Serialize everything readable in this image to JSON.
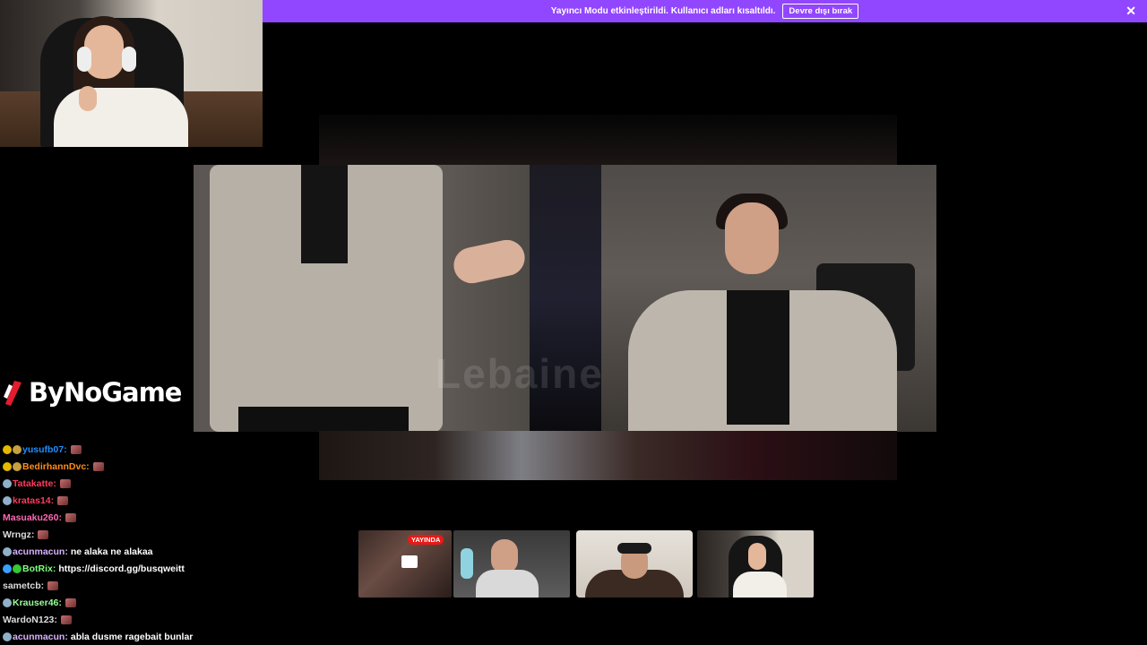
{
  "banner": {
    "message": "Yayıncı Modu etkinleştirildi. Kullanıcı adları kısaltıldı.",
    "button_label": "Devre dışı bırak",
    "close_glyph": "✕",
    "color": "#9146ff"
  },
  "overlay": {
    "logo_text": "ByNoGame",
    "watermark": "Lebaine",
    "live_label": "YAYINDA"
  },
  "chat": {
    "messages": [
      {
        "user": "yusufb07:",
        "color": "#1e90ff",
        "text": "",
        "badges": [
          "#e6b800",
          "#c8a040"
        ],
        "emote": true
      },
      {
        "user": "BedirhannDvc:",
        "color": "#ff8c1a",
        "text": "",
        "badges": [
          "#e6b800",
          "#c8a040"
        ],
        "emote": true
      },
      {
        "user": "Tatakatte:",
        "color": "#ff3b5c",
        "text": "",
        "badges": [
          "#8fb0c8"
        ],
        "emote": true
      },
      {
        "user": "kratas14:",
        "color": "#ff3b5c",
        "text": "",
        "badges": [
          "#8fb0c8"
        ],
        "emote": true
      },
      {
        "user": "Masuaku260:",
        "color": "#ff69b4",
        "text": "",
        "badges": [],
        "emote": true
      },
      {
        "user": "Wrngz:",
        "color": "#dcdcdc",
        "text": "",
        "badges": [],
        "emote": true
      },
      {
        "user": "acunmacun:",
        "color": "#d8b4fe",
        "text": "ne alaka ne alakaa",
        "badges": [
          "#8fb0c8"
        ],
        "emote": false
      },
      {
        "user": "BotRix:",
        "color": "#7fff7f",
        "text": "https://discord.gg/busqweitt",
        "badges": [
          "#3aa0ff",
          "#35c935"
        ],
        "emote": false
      },
      {
        "user": "sametcb:",
        "color": "#dcdcdc",
        "text": "",
        "badges": [],
        "emote": true
      },
      {
        "user": "Krauser46:",
        "color": "#9aff9a",
        "text": "",
        "badges": [
          "#8fb0c8"
        ],
        "emote": true
      },
      {
        "user": "WardoN123:",
        "color": "#dcdcdc",
        "text": "",
        "badges": [],
        "emote": true
      },
      {
        "user": "acunmacun:",
        "color": "#d8b4fe",
        "text": "abla dusme ragebait bunlar",
        "badges": [
          "#8fb0c8"
        ],
        "emote": false
      }
    ]
  }
}
